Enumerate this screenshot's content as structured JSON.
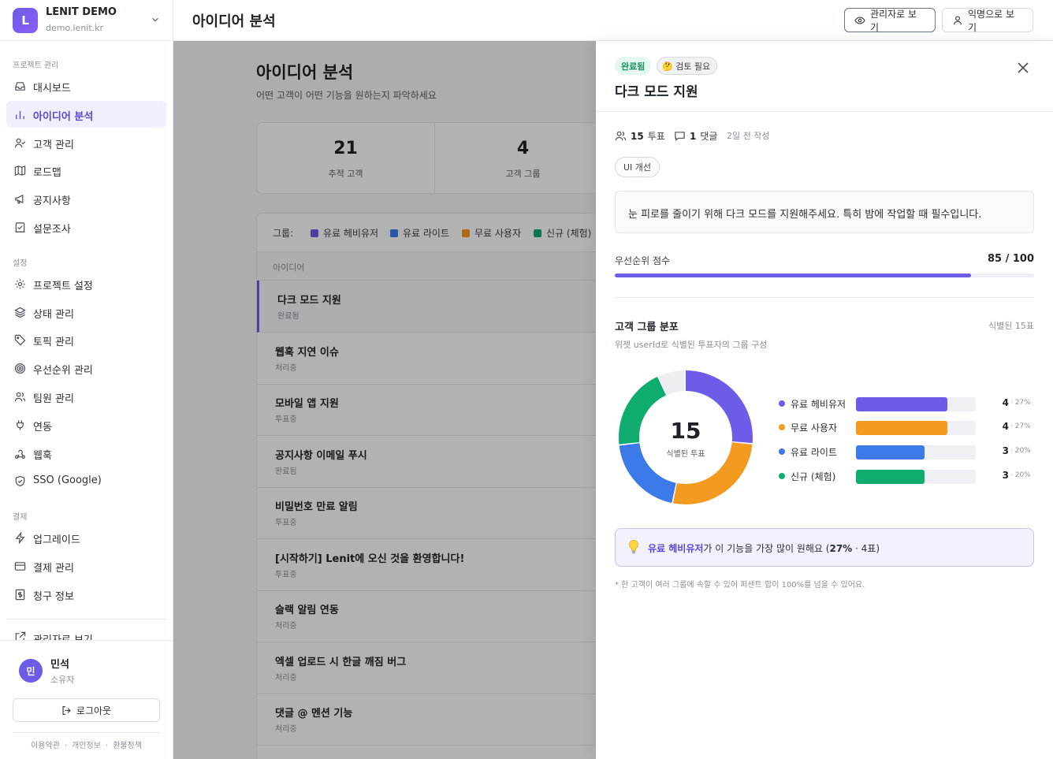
{
  "org": {
    "initial": "L",
    "name": "LENIT DEMO",
    "domain": "demo.lenit.kr"
  },
  "sidebar": {
    "section_project": "프로젝트 관리",
    "project_items": [
      {
        "label": "대시보드",
        "icon": "inbox-icon"
      },
      {
        "label": "아이디어 분석",
        "icon": "bar-chart-icon"
      },
      {
        "label": "고객 관리",
        "icon": "user-check-icon"
      },
      {
        "label": "로드맵",
        "icon": "map-icon"
      },
      {
        "label": "공지사항",
        "icon": "megaphone-icon"
      },
      {
        "label": "설문조사",
        "icon": "survey-icon"
      }
    ],
    "section_settings": "설정",
    "settings_items": [
      {
        "label": "프로젝트 설정",
        "icon": "gear-icon"
      },
      {
        "label": "상태 관리",
        "icon": "layers-icon"
      },
      {
        "label": "토픽 관리",
        "icon": "tag-icon"
      },
      {
        "label": "우선순위 관리",
        "icon": "target-icon"
      },
      {
        "label": "팀원 관리",
        "icon": "users-icon"
      },
      {
        "label": "연동",
        "icon": "plug-icon"
      },
      {
        "label": "웹훅",
        "icon": "webhook-icon"
      },
      {
        "label": "SSO (Google)",
        "icon": "shield-icon"
      }
    ],
    "section_billing": "결제",
    "billing_items": [
      {
        "label": "업그레이드",
        "icon": "bolt-icon"
      },
      {
        "label": "결제 관리",
        "icon": "card-icon"
      },
      {
        "label": "청구 정보",
        "icon": "receipt-icon"
      }
    ],
    "cut_item": "관리자로 보기"
  },
  "user": {
    "initial": "민",
    "name": "민석",
    "role": "소유자",
    "logout": "로그아웃"
  },
  "footer": {
    "terms": "이용약관",
    "privacy": "개인정보",
    "refund": "환불정책"
  },
  "header": {
    "title": "아이디어 분석",
    "admin_view": "관리자로 보기",
    "anon_view": "익명으로 보기"
  },
  "page": {
    "title": "아이디어 분석",
    "subtitle": "어떤 고객이 어떤 기능을 원하는지 파악하세요",
    "stats": [
      {
        "value": "21",
        "label": "추적 고객"
      },
      {
        "value": "4",
        "label": "고객 그룹"
      }
    ],
    "legend_label": "그룹:",
    "legend": [
      {
        "name": "유료 헤비유저",
        "color": "#6d5ce7"
      },
      {
        "name": "유료 라이트",
        "color": "#3b7ae8"
      },
      {
        "name": "무료 사용자",
        "color": "#f39a21"
      },
      {
        "name": "신규 (체험)",
        "color": "#0fab6f"
      }
    ],
    "column_header": "아이디어",
    "ideas": [
      {
        "title": "다크 모드 지원",
        "status": "완료됨"
      },
      {
        "title": "웹훅 지연 이슈",
        "status": "처리중"
      },
      {
        "title": "모바일 앱 지원",
        "status": "투표중"
      },
      {
        "title": "공지사항 이메일 푸시",
        "status": "완료됨"
      },
      {
        "title": "비밀번호 만료 알림",
        "status": "투표중"
      },
      {
        "title": "[시작하기] Lenit에 오신 것을 환영합니다!",
        "status": "투표중"
      },
      {
        "title": "슬랙 알림 연동",
        "status": "처리중"
      },
      {
        "title": "엑셀 업로드 시 한글 깨짐 버그",
        "status": "처리중"
      },
      {
        "title": "댓글 @ 멘션 기능",
        "status": "처리중"
      }
    ]
  },
  "drawer": {
    "status_badge": "완료됨",
    "review_badge": "🤔 검토 필요",
    "title": "다크 모드 지원",
    "votes_num": "15",
    "votes_unit": "투표",
    "comments_num": "1",
    "comments_unit": "댓글",
    "time": "2일 전 작성",
    "tag": "UI 개선",
    "description": "눈 피로를 줄이기 위해 다크 모드를 지원해주세요. 특히 밤에 작업할 때 필수입니다.",
    "priority_label": "우선순위 점수",
    "priority_value": "85 / 100",
    "priority_score": 85,
    "priority_max": 100,
    "dist_title": "고객 그룹 분포",
    "dist_count": "식별된 15표",
    "dist_sub": "위젯 userId로 식별된 투표자의 그룹 구성",
    "donut_total": "15",
    "donut_caption": "식별된 투표",
    "groups": [
      {
        "name": "유료 헤비유저",
        "count": 4,
        "count_label": "4",
        "pct": "· 27%",
        "color": "#6d5ce7"
      },
      {
        "name": "무료 사용자",
        "count": 4,
        "count_label": "4",
        "pct": "· 27%",
        "color": "#f39a21"
      },
      {
        "name": "유료 라이트",
        "count": 3,
        "count_label": "3",
        "pct": "· 20%",
        "color": "#3b7ae8"
      },
      {
        "name": "신규 (체험)",
        "count": 3,
        "count_label": "3",
        "pct": "· 20%",
        "color": "#0fab6f"
      }
    ],
    "donut_remainder": 1,
    "donut_remainder_color": "#eceef1",
    "insight_group": "유료 헤비유저",
    "insight_mid": "가 이 기능을 가장 많이 원해요 (",
    "insight_pct": "27%",
    "insight_tail": " · 4표)",
    "footnote": "* 한 고객이 여러 그룹에 속할 수 있어 퍼센트 합이 100%를 넘을 수 있어요."
  }
}
